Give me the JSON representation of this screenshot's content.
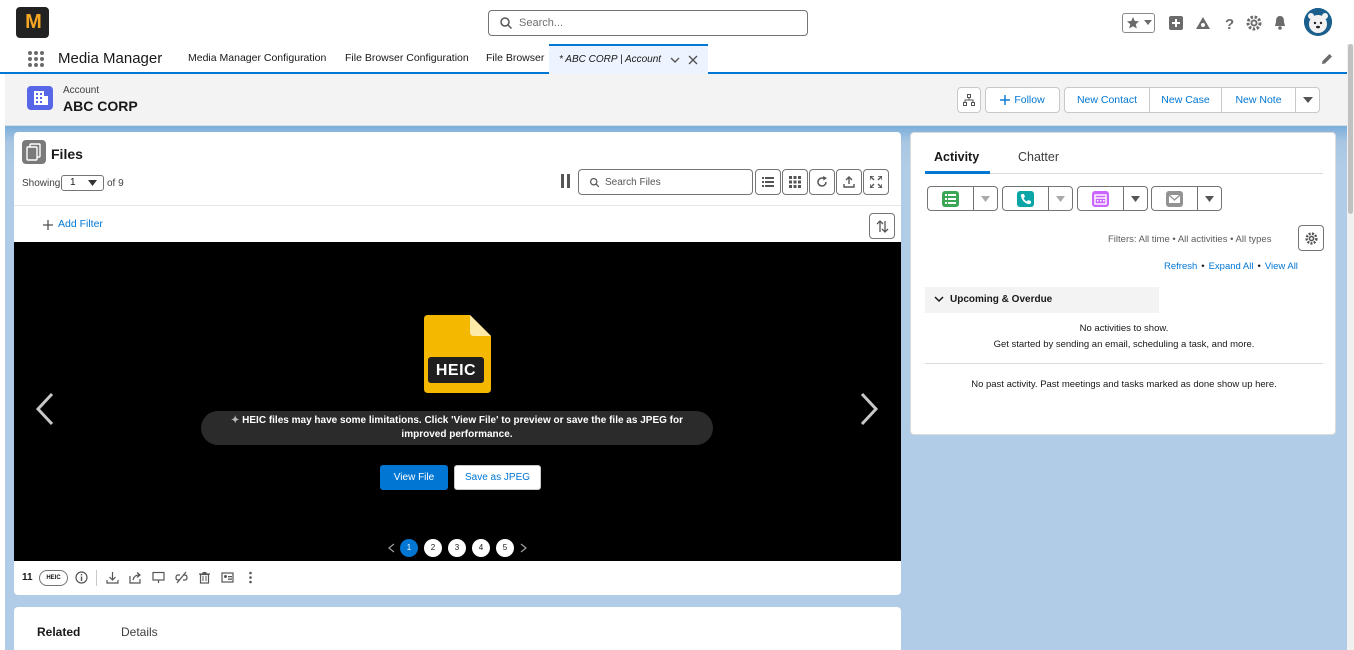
{
  "global_header": {
    "logo_text": "M",
    "search_placeholder": "Search..."
  },
  "nav": {
    "app_name": "Media Manager",
    "items": [
      {
        "label": "Media Manager Configuration"
      },
      {
        "label": "File Browser Configuration"
      },
      {
        "label": "File Browser"
      }
    ],
    "active_tab": "* ABC CORP | Account"
  },
  "record": {
    "type": "Account",
    "name": "ABC CORP",
    "actions": {
      "follow": "Follow",
      "new_contact": "New Contact",
      "new_case": "New Case",
      "new_note": "New Note"
    }
  },
  "files": {
    "title": "Files",
    "showing_label": "Showing",
    "showing_value": "1",
    "of_label": "of 9",
    "search_placeholder": "Search Files",
    "add_filter": "Add Filter",
    "file_type_label": "HEIC",
    "notice": "HEIC files may have some limitations. Click 'View File' to preview or save the file as JPEG for improved performance.",
    "view_file": "View File",
    "save_jpeg": "Save as JPEG",
    "pages": [
      "1",
      "2",
      "3",
      "4",
      "5"
    ],
    "active_page": "1",
    "file_count": "11",
    "ext_badge": "HEIC"
  },
  "related": {
    "tabs": [
      "Related",
      "Details"
    ]
  },
  "activity": {
    "tabs": [
      "Activity",
      "Chatter"
    ],
    "filters_text": "Filters: All time • All activities • All types",
    "links": [
      "Refresh",
      "Expand All",
      "View All"
    ],
    "upcoming": "Upcoming & Overdue",
    "no_activities": "No activities to show.",
    "get_started": "Get started by sending an email, scheduling a task, and more.",
    "no_past": "No past activity. Past meetings and tasks marked as done show up here."
  },
  "colors": {
    "brand": "#0176d3",
    "task": "#3ba755",
    "call": "#0ba5a7",
    "event": "#cb65ff",
    "email": "#939393"
  }
}
